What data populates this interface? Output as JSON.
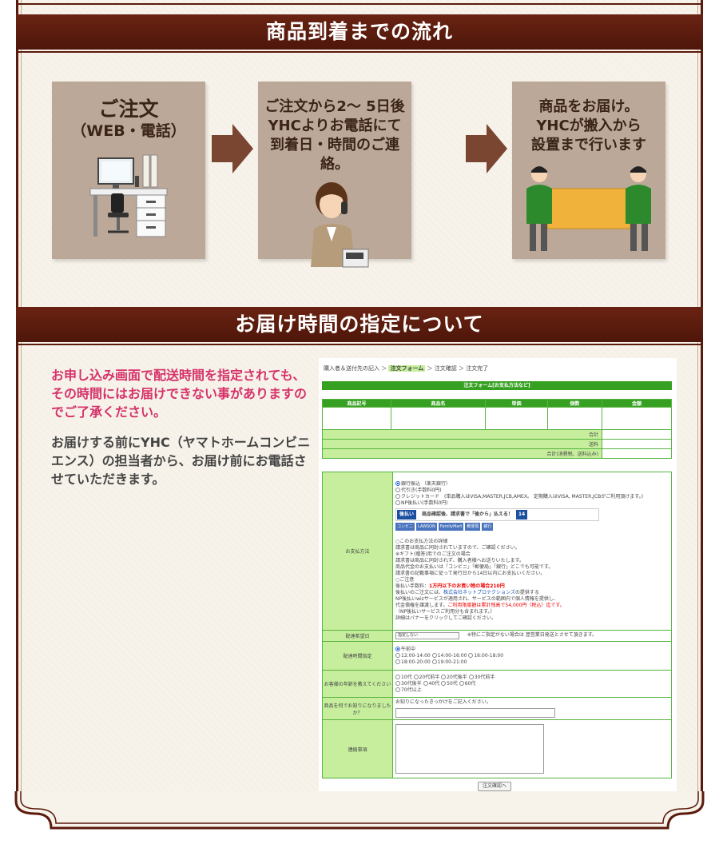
{
  "section1": {
    "title": "商品到着までの流れ"
  },
  "steps": [
    {
      "title": "ご注文",
      "subtitle": "（WEB・電話）"
    },
    {
      "line1": "ご注文から2～ 5日後",
      "line2": "YHCよりお電話にて",
      "line3": "到着日・時間のご連絡。"
    },
    {
      "line1": "商品をお届け。",
      "line2": "YHCが搬入から",
      "line3": "設置まで行います"
    }
  ],
  "section2": {
    "title": "お届け時間の指定について"
  },
  "notes": {
    "red": "お申し込み画面で配送時間を指定されても、その時間にはお届けできない事がありますのでご了承ください。",
    "grey": "お届けする前にYHC（ヤマトホームコンビニエンス）の担当者から、お届け前にお電話させていただきます。"
  },
  "form": {
    "crumb_1": "購入者＆送付先の記入 ＞",
    "crumb_active": "注文フォーム",
    "crumb_2": "＞ 注文確認 ＞ 注文完了",
    "header": "注文フォーム[お支払方法など]",
    "cols": [
      "商品記号",
      "商品名",
      "単価",
      "個数",
      "金額"
    ],
    "subtotal": "合計",
    "shipping": "送料",
    "total": "合計(消費税、送料込み)",
    "payment_label": "お支払方法",
    "payment_options": [
      "銀行振込 （楽天銀行）",
      "代引き(手数料0円)",
      "クレジットカード　(単品購入はVISA,MASTER,JCB,AMEX。 定期購入はVISA, MASTER,JCBがご利用頂けます。)",
      "NP後払い(手数料0円)"
    ],
    "np_badge": "後払い",
    "np_text": "商品確認後、請求書で「後から」払える！",
    "np_days": "14",
    "np_stores": [
      "コンビニ",
      "LAWSON",
      "FamilyMart",
      "郵便局",
      "銀行"
    ],
    "np_details": [
      "○このお支払方法の詳細",
      "請求書は商品に同封されていますので、ご確認ください。",
      "※ギフト(贈答)用でのご注文の場合",
      "請求書は商品に同封されず、購入者様へお送りいたします。",
      "商品代金のお支払いは「コンビニ」「郵便局」「銀行」どこでも可能です。",
      "請求書の記載事項に従って発行日から14日以内にお支払いください。",
      "○ご注意"
    ],
    "fee_prefix": "後払い手数料：",
    "fee_red": "1万円以下のお買い物の場合210円",
    "np_service_prefix": "後払いのご注文には、",
    "np_service_link": "株式会社ネットプロテクションズ",
    "np_service_suffix": "の提供する",
    "np_service_2": "NP後払いwizサービスが適用され、サービスの範囲内で個人情報を提供し、",
    "np_service_3_prefix": "代金債権を譲渡します。",
    "np_service_3_red": "ご利用限度額は累計残高で54,000円（税込）迄です。",
    "np_service_4": "（NP後払いサービスご利用分も含まれます。）",
    "np_service_5": "詳細はバナーをクリックしてご確認ください。",
    "date_label": "配達希望日",
    "date_select": "指定しない",
    "date_note": "※特にご指定がない場合は 翌営業日発送とさせて頂きます。",
    "time_label": "配達時間指定",
    "time_options": [
      "午前中",
      "12:00-14:00",
      "14:00-16:00",
      "16:00-18:00",
      "18:00-20:00",
      "19:00-21:00"
    ],
    "age_label": "お客様の年齢を教えてください",
    "age_options": [
      "10代",
      "20代前半",
      "20代後半",
      "30代前半",
      "30代後半",
      "40代",
      "50代",
      "60代",
      "70代以上"
    ],
    "source_label": "商品を何でお知りになりましたか？",
    "source_hint": "お知りになったきっかけをご記入ください。",
    "contact_label": "連絡事項",
    "confirm_button": "注文確認へ"
  }
}
